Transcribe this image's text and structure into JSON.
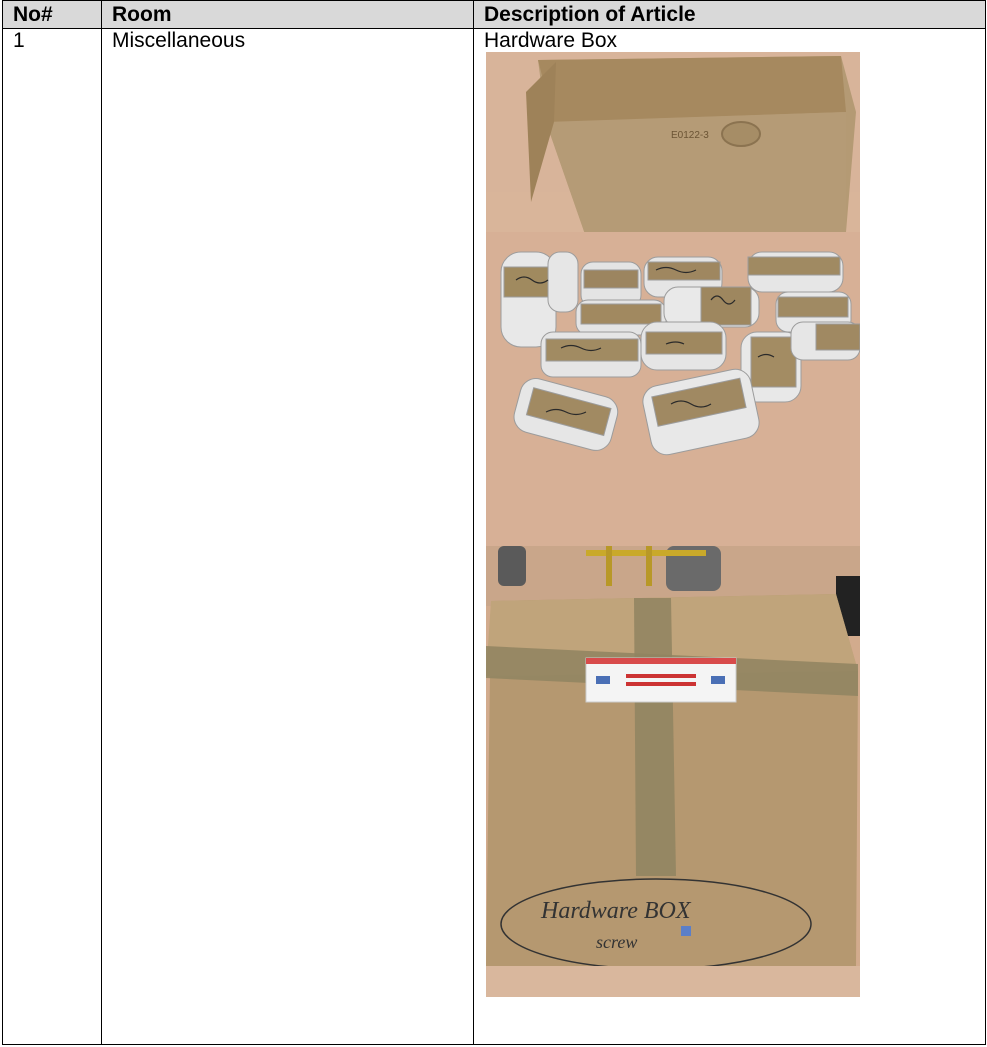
{
  "table": {
    "headers": {
      "no": "No#",
      "room": "Room",
      "description": "Description of Article"
    },
    "rows": [
      {
        "no": "1",
        "room": "Miscellaneous",
        "description": "Hardware Box",
        "photos": [
          {
            "name": "wrapped-hardware-packages-photo",
            "marker_label": "E0122-3"
          },
          {
            "name": "sealed-hardware-box-photo",
            "marker_label": "Hardware BOX",
            "marker_sub": "screw"
          }
        ]
      }
    ]
  }
}
